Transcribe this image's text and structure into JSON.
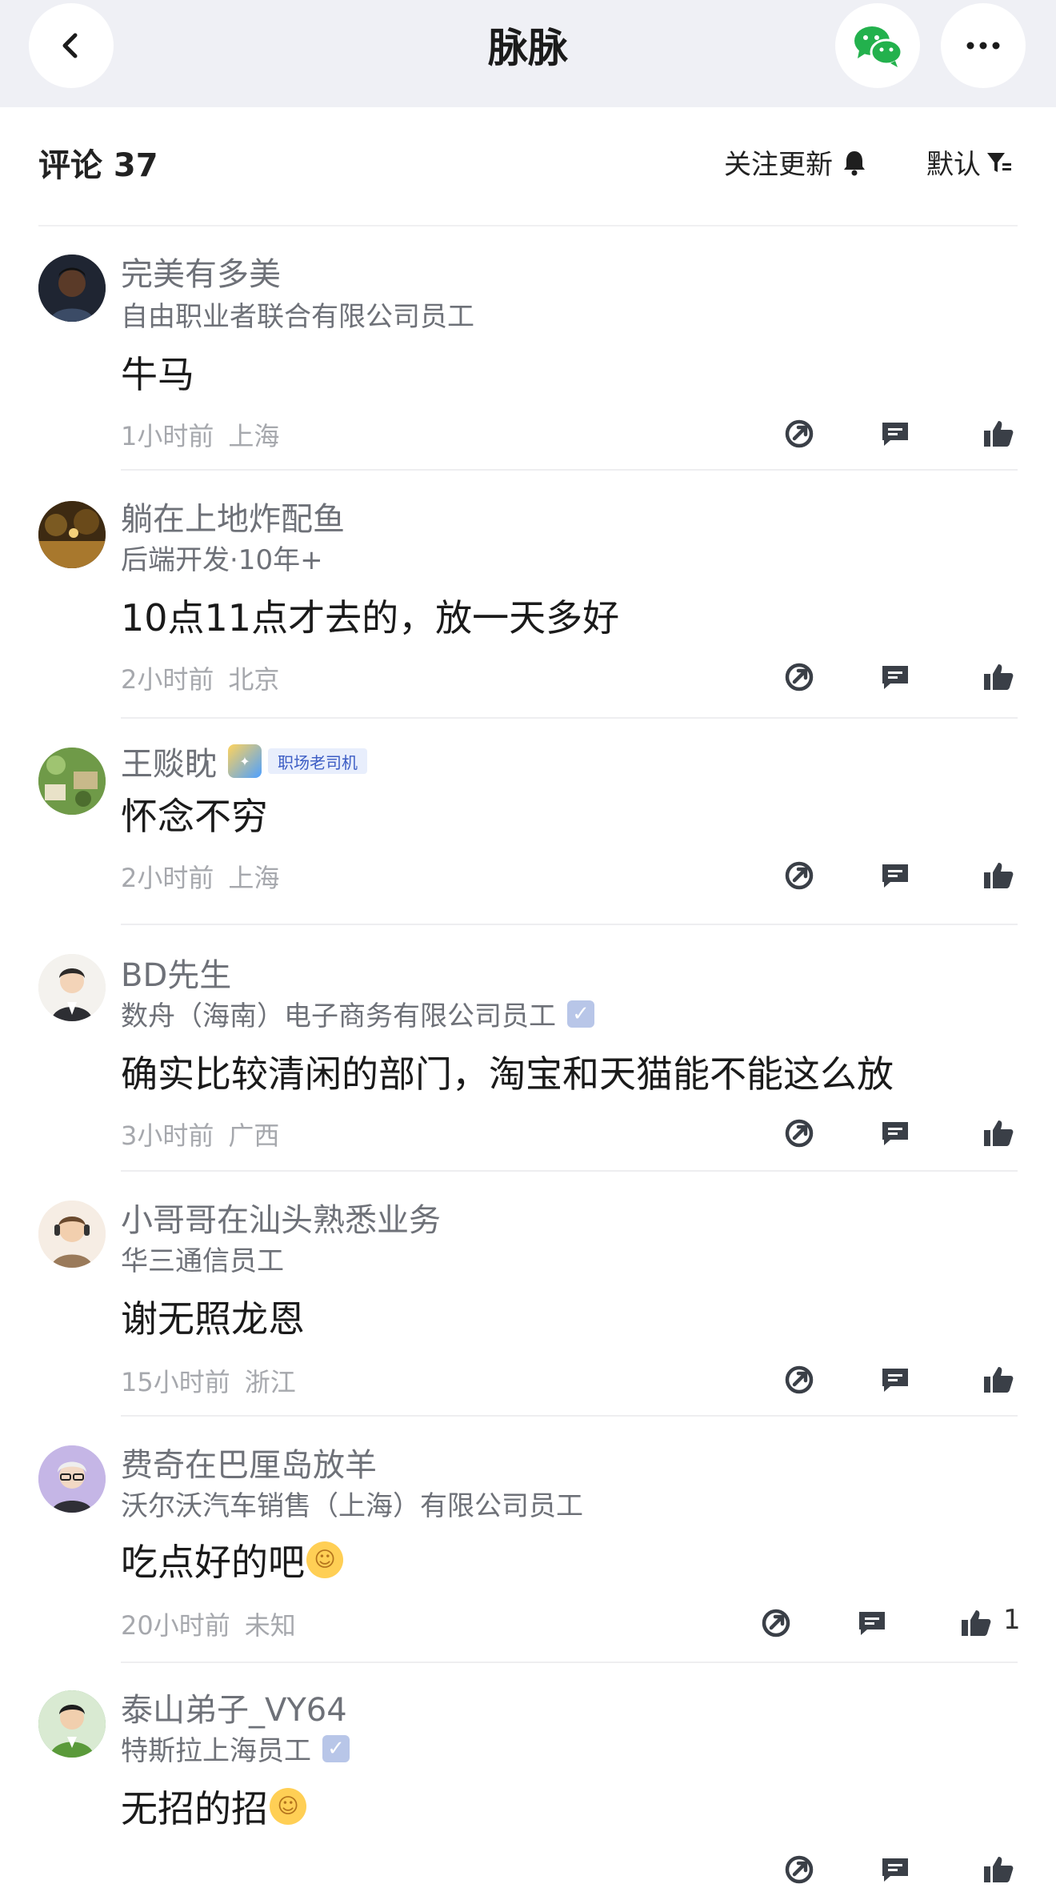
{
  "nav": {
    "title": "脉脉"
  },
  "comments_header": {
    "title": "评论 37",
    "follow_label": "关注更新",
    "sort_label": "默认"
  },
  "comments": [
    {
      "name": "完美有多美",
      "subtitle": "自由职业者联合有限公司员工",
      "text": "牛马",
      "time": "1小时前",
      "location": "上海",
      "avatar_color": "#2b2f3a"
    },
    {
      "name": "躺在上地炸配鱼",
      "subtitle": "后端开发·10年+",
      "text": "10点11点才去的，放一天多好",
      "time": "2小时前",
      "location": "北京",
      "avatar_color": "#6b4a1e"
    },
    {
      "name": "王赕眈",
      "badge_label": "职场老司机",
      "text": "怀念不穷",
      "time": "2小时前",
      "location": "上海",
      "avatar_color": "#7aa35a"
    },
    {
      "name": "BD先生",
      "subtitle": "数舟（海南）电子商务有限公司员工",
      "text": "确实比较清闲的部门，淘宝和天猫能不能这么放",
      "time": "3小时前",
      "location": "广西",
      "avatar_color": "#e9e6e2"
    },
    {
      "name": "小哥哥在汕头熟悉业务",
      "subtitle": "华三通信员工",
      "text": "谢无照龙恩",
      "time": "15小时前",
      "location": "浙江",
      "avatar_color": "#f1e6da"
    },
    {
      "name": "费奇在巴厘岛放羊",
      "subtitle": "沃尔沃汽车销售（上海）有限公司员工",
      "text": "吃点好的吧",
      "time": "20小时前",
      "location": "未知",
      "like_count": "1",
      "avatar_color": "#c7b8e6"
    },
    {
      "name": "泰山弟子_VY64",
      "subtitle": "特斯拉上海员工",
      "text": "无招的招",
      "avatar_color": "#6aa86a"
    }
  ],
  "icons": {
    "back": "chevron-left-icon",
    "wechat": "wechat-icon",
    "more": "more-icon",
    "bell": "bell-icon",
    "filter": "filter-icon",
    "share": "share-icon",
    "reply": "comment-icon",
    "like": "thumbs-up-icon"
  },
  "colors": {
    "nav_bg": "#eff0f5",
    "wechat_green": "#23b14d",
    "meta_gray": "#a6a8ad"
  }
}
